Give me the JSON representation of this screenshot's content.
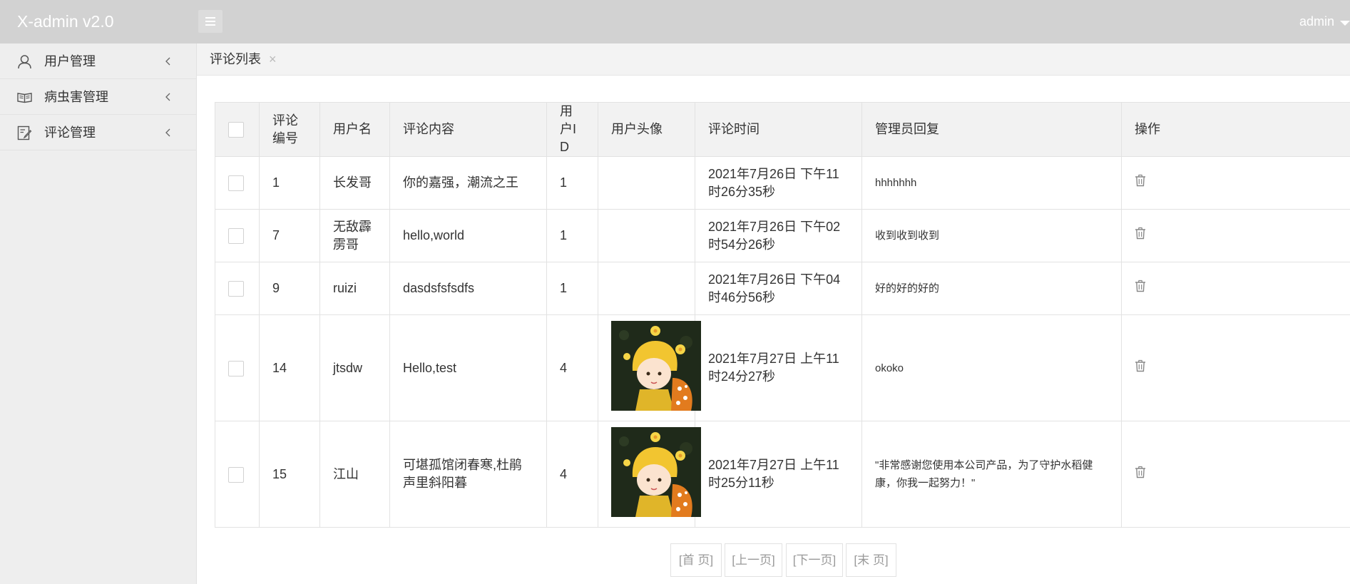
{
  "app": {
    "title": "X-admin v2.0",
    "user": "admin"
  },
  "sidebar": {
    "items": [
      {
        "label": "用户管理",
        "icon": "user-icon"
      },
      {
        "label": "病虫害管理",
        "icon": "book-icon"
      },
      {
        "label": "评论管理",
        "icon": "edit-note-icon"
      }
    ]
  },
  "tabs": [
    {
      "label": "评论列表",
      "close": "×"
    }
  ],
  "table": {
    "headers": [
      "评论编号",
      "用户名",
      "评论内容",
      "用户ID",
      "用户头像",
      "评论时间",
      "管理员回复",
      "操作"
    ],
    "rows": [
      {
        "id": "1",
        "username": "长发哥",
        "content": "你的嘉强，潮流之王",
        "user_id": "1",
        "has_avatar": false,
        "time": "2021年7月26日 下午11时26分35秒",
        "reply": "hhhhhhh"
      },
      {
        "id": "7",
        "username": "无敌霹雳哥",
        "content": "hello,world",
        "user_id": "1",
        "has_avatar": false,
        "time": "2021年7月26日 下午02时54分26秒",
        "reply": "收到收到收到"
      },
      {
        "id": "9",
        "username": "ruizi",
        "content": "dasdsfsfsdfs",
        "user_id": "1",
        "has_avatar": false,
        "time": "2021年7月26日 下午04时46分56秒",
        "reply": "好的好的好的"
      },
      {
        "id": "14",
        "username": "jtsdw",
        "content": "Hello,test",
        "user_id": "4",
        "has_avatar": true,
        "time": "2021年7月27日 上午11时24分27秒",
        "reply": "okoko"
      },
      {
        "id": "15",
        "username": "江山",
        "content": "可堪孤馆闭春寒,杜鹃声里斜阳暮",
        "user_id": "4",
        "has_avatar": true,
        "time": "2021年7月27日 上午11时25分11秒",
        "reply": "\"非常感谢您使用本公司产品，为了守护水稻健康，你我一起努力！\""
      }
    ]
  },
  "pager": {
    "first": "[首 页]",
    "prev": "[上一页]",
    "next": "[下一页]",
    "last": "[末 页]"
  },
  "colors": {
    "topbar": "#d2d2d2",
    "sidebar": "#eeeeee",
    "header_row": "#f2f2f2",
    "border": "#e2e2e2"
  }
}
